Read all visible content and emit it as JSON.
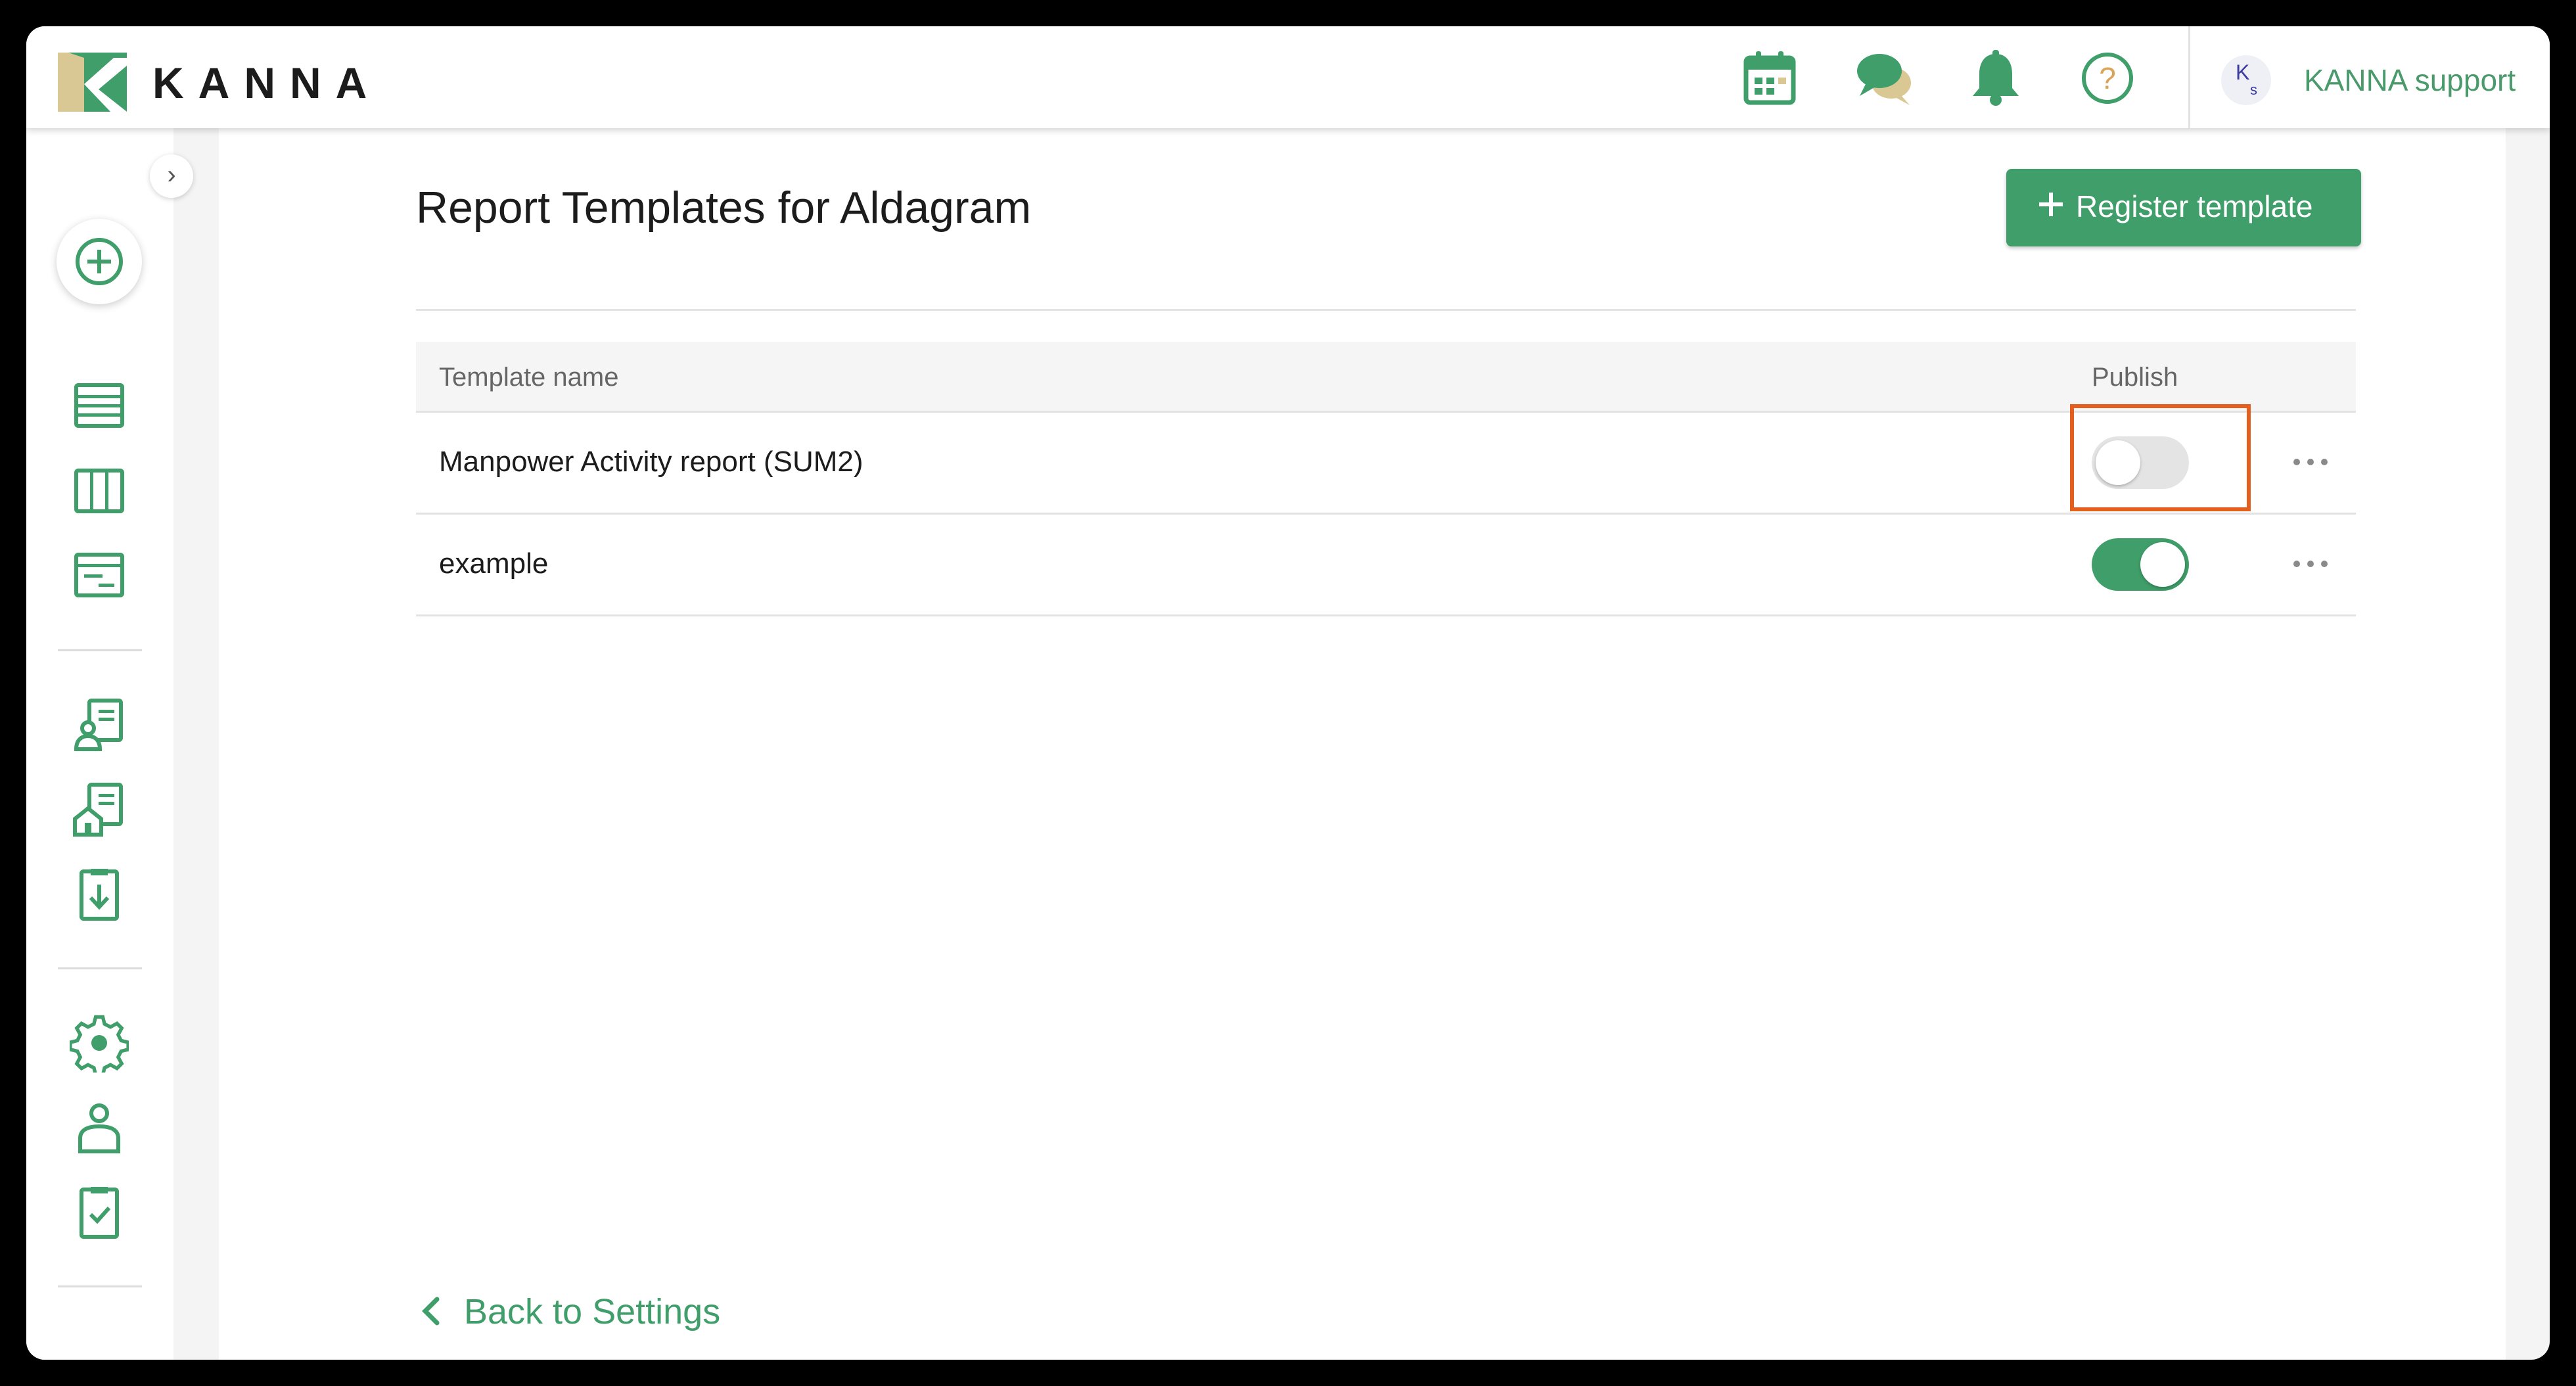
{
  "header": {
    "brand": "KANNA",
    "icons": [
      "calendar-icon",
      "chat-icon",
      "bell-icon",
      "help-icon"
    ],
    "avatar_initials": [
      "K",
      "s"
    ],
    "user_name": "KANNA support"
  },
  "sidebar": {
    "collapse_glyph": "›",
    "groups": [
      [
        "add-icon"
      ],
      [
        "list-icon",
        "board-icon",
        "schedule-icon"
      ],
      [
        "customer-icon",
        "property-icon",
        "download-icon"
      ],
      [
        "settings-icon",
        "user-icon",
        "checklist-icon"
      ]
    ]
  },
  "page": {
    "title": "Report Templates for Aldagram",
    "register_button": "Register template",
    "table": {
      "columns": [
        "Template name",
        "Publish"
      ],
      "rows": [
        {
          "name": "Manpower Activity report (SUM2)",
          "published": false
        },
        {
          "name": "example",
          "published": true
        }
      ]
    },
    "back_link": "Back to Settings"
  },
  "colors": {
    "accent": "#3f9e69",
    "logo_light": "#d9c894",
    "highlight": "#e45f1e"
  }
}
